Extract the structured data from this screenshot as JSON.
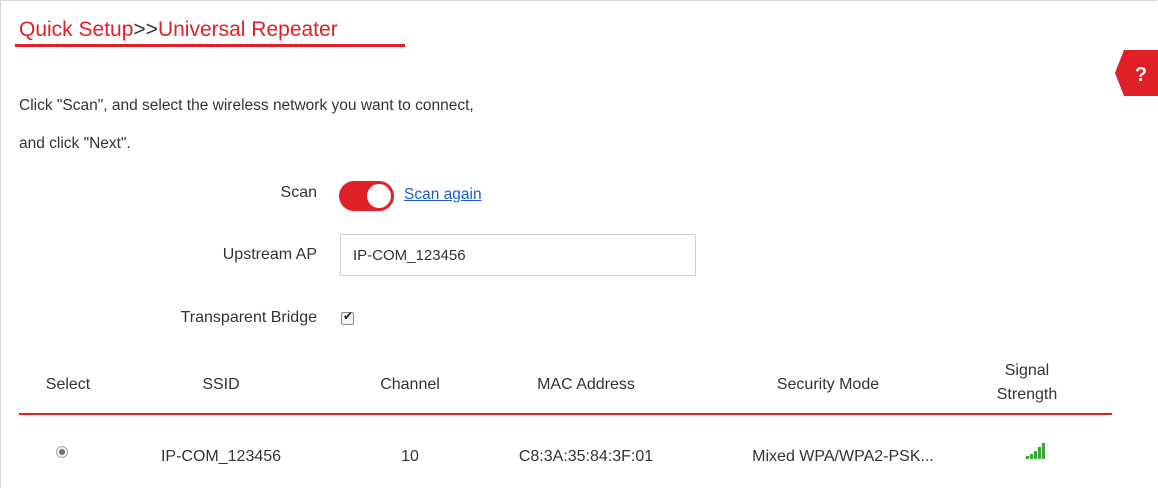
{
  "breadcrumb": {
    "parent": "Quick Setup",
    "separator": ">>",
    "current": "Universal Repeater"
  },
  "help": {
    "label": "?"
  },
  "instructions": {
    "line1": "Click \"Scan\", and select the wireless network you want to connect,",
    "line2": "and click \"Next\"."
  },
  "form": {
    "scan_label": "Scan",
    "scan_enabled": true,
    "scan_again_link": "Scan again",
    "upstream_ap_label": "Upstream AP",
    "upstream_ap_value": "IP-COM_123456",
    "transparent_bridge_label": "Transparent Bridge",
    "transparent_bridge_checked": true
  },
  "table": {
    "headers": {
      "select": "Select",
      "ssid": "SSID",
      "channel": "Channel",
      "mac": "MAC Address",
      "security": "Security Mode",
      "signal_line1": "Signal",
      "signal_line2": "Strength"
    },
    "rows": [
      {
        "selected": true,
        "ssid": "IP-COM_123456",
        "channel": "10",
        "mac": "C8:3A:35:84:3F:01",
        "security": "Mixed WPA/WPA2-PSK...",
        "signal_icon": "signal-strength-icon"
      }
    ]
  },
  "colors": {
    "accent": "#e11f26",
    "link": "#1a5dc8",
    "signal": "#3aa635"
  }
}
